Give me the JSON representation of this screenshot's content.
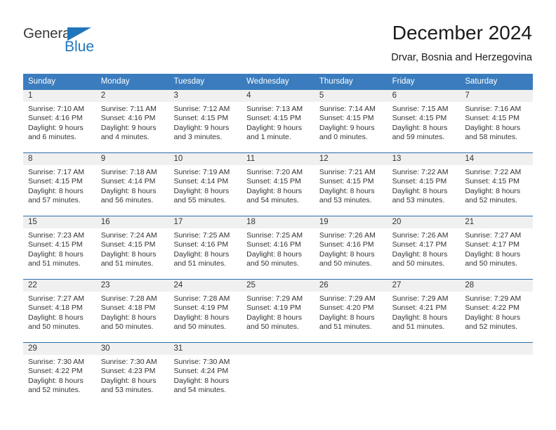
{
  "brand": {
    "name_part1": "General",
    "name_part2": "Blue",
    "accent_color": "#1f76bd"
  },
  "header": {
    "month_title": "December 2024",
    "location": "Drvar, Bosnia and Herzegovina"
  },
  "calendar": {
    "header_bg": "#3a7cbe",
    "daynum_band_bg": "#f0f0f0",
    "weekdays": [
      "Sunday",
      "Monday",
      "Tuesday",
      "Wednesday",
      "Thursday",
      "Friday",
      "Saturday"
    ],
    "weeks": [
      [
        {
          "day": "1",
          "sunrise": "Sunrise: 7:10 AM",
          "sunset": "Sunset: 4:16 PM",
          "daylight": "Daylight: 9 hours and 6 minutes."
        },
        {
          "day": "2",
          "sunrise": "Sunrise: 7:11 AM",
          "sunset": "Sunset: 4:16 PM",
          "daylight": "Daylight: 9 hours and 4 minutes."
        },
        {
          "day": "3",
          "sunrise": "Sunrise: 7:12 AM",
          "sunset": "Sunset: 4:15 PM",
          "daylight": "Daylight: 9 hours and 3 minutes."
        },
        {
          "day": "4",
          "sunrise": "Sunrise: 7:13 AM",
          "sunset": "Sunset: 4:15 PM",
          "daylight": "Daylight: 9 hours and 1 minute."
        },
        {
          "day": "5",
          "sunrise": "Sunrise: 7:14 AM",
          "sunset": "Sunset: 4:15 PM",
          "daylight": "Daylight: 9 hours and 0 minutes."
        },
        {
          "day": "6",
          "sunrise": "Sunrise: 7:15 AM",
          "sunset": "Sunset: 4:15 PM",
          "daylight": "Daylight: 8 hours and 59 minutes."
        },
        {
          "day": "7",
          "sunrise": "Sunrise: 7:16 AM",
          "sunset": "Sunset: 4:15 PM",
          "daylight": "Daylight: 8 hours and 58 minutes."
        }
      ],
      [
        {
          "day": "8",
          "sunrise": "Sunrise: 7:17 AM",
          "sunset": "Sunset: 4:15 PM",
          "daylight": "Daylight: 8 hours and 57 minutes."
        },
        {
          "day": "9",
          "sunrise": "Sunrise: 7:18 AM",
          "sunset": "Sunset: 4:14 PM",
          "daylight": "Daylight: 8 hours and 56 minutes."
        },
        {
          "day": "10",
          "sunrise": "Sunrise: 7:19 AM",
          "sunset": "Sunset: 4:14 PM",
          "daylight": "Daylight: 8 hours and 55 minutes."
        },
        {
          "day": "11",
          "sunrise": "Sunrise: 7:20 AM",
          "sunset": "Sunset: 4:15 PM",
          "daylight": "Daylight: 8 hours and 54 minutes."
        },
        {
          "day": "12",
          "sunrise": "Sunrise: 7:21 AM",
          "sunset": "Sunset: 4:15 PM",
          "daylight": "Daylight: 8 hours and 53 minutes."
        },
        {
          "day": "13",
          "sunrise": "Sunrise: 7:22 AM",
          "sunset": "Sunset: 4:15 PM",
          "daylight": "Daylight: 8 hours and 53 minutes."
        },
        {
          "day": "14",
          "sunrise": "Sunrise: 7:22 AM",
          "sunset": "Sunset: 4:15 PM",
          "daylight": "Daylight: 8 hours and 52 minutes."
        }
      ],
      [
        {
          "day": "15",
          "sunrise": "Sunrise: 7:23 AM",
          "sunset": "Sunset: 4:15 PM",
          "daylight": "Daylight: 8 hours and 51 minutes."
        },
        {
          "day": "16",
          "sunrise": "Sunrise: 7:24 AM",
          "sunset": "Sunset: 4:15 PM",
          "daylight": "Daylight: 8 hours and 51 minutes."
        },
        {
          "day": "17",
          "sunrise": "Sunrise: 7:25 AM",
          "sunset": "Sunset: 4:16 PM",
          "daylight": "Daylight: 8 hours and 51 minutes."
        },
        {
          "day": "18",
          "sunrise": "Sunrise: 7:25 AM",
          "sunset": "Sunset: 4:16 PM",
          "daylight": "Daylight: 8 hours and 50 minutes."
        },
        {
          "day": "19",
          "sunrise": "Sunrise: 7:26 AM",
          "sunset": "Sunset: 4:16 PM",
          "daylight": "Daylight: 8 hours and 50 minutes."
        },
        {
          "day": "20",
          "sunrise": "Sunrise: 7:26 AM",
          "sunset": "Sunset: 4:17 PM",
          "daylight": "Daylight: 8 hours and 50 minutes."
        },
        {
          "day": "21",
          "sunrise": "Sunrise: 7:27 AM",
          "sunset": "Sunset: 4:17 PM",
          "daylight": "Daylight: 8 hours and 50 minutes."
        }
      ],
      [
        {
          "day": "22",
          "sunrise": "Sunrise: 7:27 AM",
          "sunset": "Sunset: 4:18 PM",
          "daylight": "Daylight: 8 hours and 50 minutes."
        },
        {
          "day": "23",
          "sunrise": "Sunrise: 7:28 AM",
          "sunset": "Sunset: 4:18 PM",
          "daylight": "Daylight: 8 hours and 50 minutes."
        },
        {
          "day": "24",
          "sunrise": "Sunrise: 7:28 AM",
          "sunset": "Sunset: 4:19 PM",
          "daylight": "Daylight: 8 hours and 50 minutes."
        },
        {
          "day": "25",
          "sunrise": "Sunrise: 7:29 AM",
          "sunset": "Sunset: 4:19 PM",
          "daylight": "Daylight: 8 hours and 50 minutes."
        },
        {
          "day": "26",
          "sunrise": "Sunrise: 7:29 AM",
          "sunset": "Sunset: 4:20 PM",
          "daylight": "Daylight: 8 hours and 51 minutes."
        },
        {
          "day": "27",
          "sunrise": "Sunrise: 7:29 AM",
          "sunset": "Sunset: 4:21 PM",
          "daylight": "Daylight: 8 hours and 51 minutes."
        },
        {
          "day": "28",
          "sunrise": "Sunrise: 7:29 AM",
          "sunset": "Sunset: 4:22 PM",
          "daylight": "Daylight: 8 hours and 52 minutes."
        }
      ],
      [
        {
          "day": "29",
          "sunrise": "Sunrise: 7:30 AM",
          "sunset": "Sunset: 4:22 PM",
          "daylight": "Daylight: 8 hours and 52 minutes."
        },
        {
          "day": "30",
          "sunrise": "Sunrise: 7:30 AM",
          "sunset": "Sunset: 4:23 PM",
          "daylight": "Daylight: 8 hours and 53 minutes."
        },
        {
          "day": "31",
          "sunrise": "Sunrise: 7:30 AM",
          "sunset": "Sunset: 4:24 PM",
          "daylight": "Daylight: 8 hours and 54 minutes."
        },
        {
          "day": "",
          "sunrise": "",
          "sunset": "",
          "daylight": ""
        },
        {
          "day": "",
          "sunrise": "",
          "sunset": "",
          "daylight": ""
        },
        {
          "day": "",
          "sunrise": "",
          "sunset": "",
          "daylight": ""
        },
        {
          "day": "",
          "sunrise": "",
          "sunset": "",
          "daylight": ""
        }
      ]
    ]
  }
}
